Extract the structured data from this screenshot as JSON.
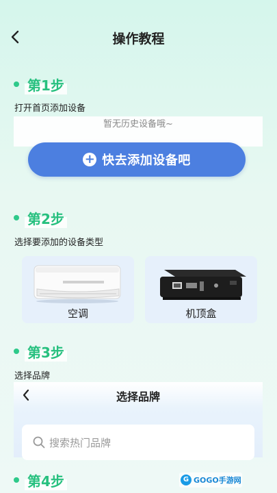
{
  "header": {
    "title": "操作教程"
  },
  "steps": [
    {
      "label": "第1步",
      "desc": "打开首页添加设备"
    },
    {
      "label": "第2步",
      "desc": "选择要添加的设备类型"
    },
    {
      "label": "第3步",
      "desc": "选择品牌"
    },
    {
      "label": "第4步"
    }
  ],
  "step1": {
    "empty_text": "暂无历史设备哦~",
    "add_button_label": "快去添加设备吧"
  },
  "step2": {
    "devices": [
      {
        "label": "空调",
        "icon": "air-conditioner-icon"
      },
      {
        "label": "机顶盒",
        "icon": "set-top-box-icon"
      }
    ]
  },
  "step3": {
    "panel_title": "选择品牌",
    "search_placeholder": "搜索热门品牌"
  },
  "watermark": {
    "text": "GOGO手游网"
  },
  "colors": {
    "accent_green": "#27c07f",
    "primary_blue": "#4c7fe0",
    "card_bg": "#e6f0fb"
  }
}
